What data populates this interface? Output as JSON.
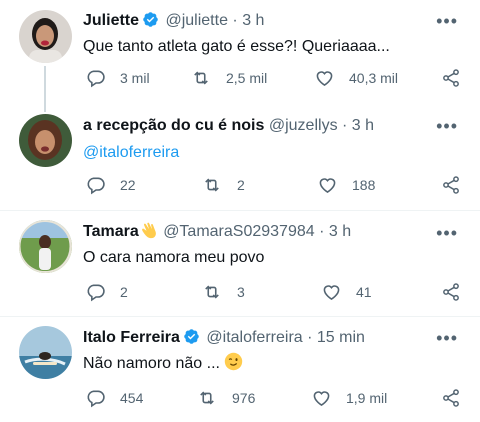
{
  "thread_line": true,
  "colors": {
    "accent": "#1d9bf0",
    "muted": "#536471",
    "text": "#0f1419",
    "divider": "#eff3f4"
  },
  "tweets": [
    {
      "name": "Juliette",
      "verified": true,
      "handle": "@juliette",
      "separator": "·",
      "time": "3 h",
      "text": "Que tanto atleta gato é esse?! Queriaaaa...",
      "replies": "3 mil",
      "retweets": "2,5 mil",
      "likes": "40,3 mil",
      "more_icon": "more-horizontal-icon"
    },
    {
      "name": "a recepção do cu é nois",
      "verified": false,
      "handle": "@juzellys",
      "separator": "·",
      "time": "3 h",
      "text": "@italoferreira",
      "replies": "22",
      "retweets": "2",
      "likes": "188",
      "more_icon": "more-horizontal-icon"
    },
    {
      "name": "Tamara",
      "name_emoji": "waving-hand-emoji",
      "verified": false,
      "handle": "@TamaraS02937984",
      "separator": "·",
      "time": "3 h",
      "text": "O cara namora meu povo",
      "replies": "2",
      "retweets": "3",
      "likes": "41",
      "more_icon": "more-horizontal-icon"
    },
    {
      "name": "Italo Ferreira",
      "verified": true,
      "handle": "@italoferreira",
      "separator": "·",
      "time": "15 min",
      "text": "Não namoro não ...",
      "text_emoji": "winking-face-emoji",
      "replies": "454",
      "retweets": "976",
      "likes": "1,9 mil",
      "more_icon": "more-horizontal-icon"
    }
  ]
}
